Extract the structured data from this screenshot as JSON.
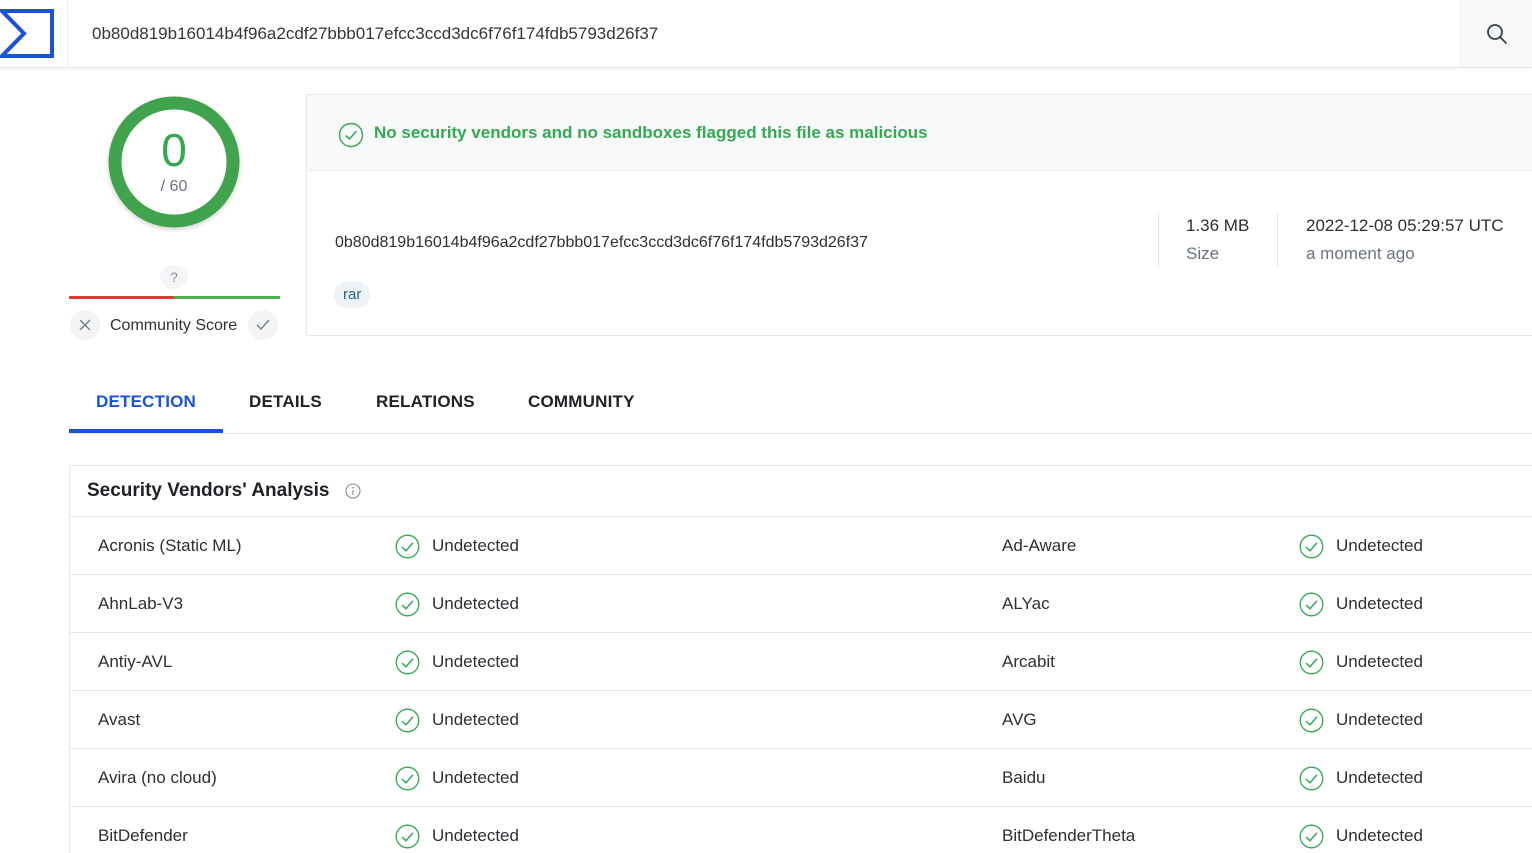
{
  "search": {
    "value": "0b80d819b16014b4f96a2cdf27bbb017efcc3ccd3dc6f76f174fdb5793d26f37",
    "icon": "search-icon"
  },
  "score": {
    "detections": "0",
    "total": "/ 60",
    "ring_color": "#34a853",
    "community_unknown": "?",
    "community_label": "Community Score"
  },
  "summary": {
    "status": "No security vendors and no sandboxes flagged this file as malicious",
    "hash": "0b80d819b16014b4f96a2cdf27bbb017efcc3ccd3dc6f76f174fdb5793d26f37",
    "tag": "rar",
    "size_value": "1.36 MB",
    "size_label": "Size",
    "date_value": "2022-12-08 05:29:57 UTC",
    "date_relative": "a moment ago"
  },
  "tabs": [
    {
      "label": "DETECTION",
      "active": true
    },
    {
      "label": "DETAILS",
      "active": false
    },
    {
      "label": "RELATIONS",
      "active": false
    },
    {
      "label": "COMMUNITY",
      "active": false
    }
  ],
  "analysis": {
    "title": "Security Vendors' Analysis",
    "rows": [
      {
        "left_vendor": "Acronis (Static ML)",
        "left_result": "Undetected",
        "right_vendor": "Ad-Aware",
        "right_result": "Undetected"
      },
      {
        "left_vendor": "AhnLab-V3",
        "left_result": "Undetected",
        "right_vendor": "ALYac",
        "right_result": "Undetected"
      },
      {
        "left_vendor": "Antiy-AVL",
        "left_result": "Undetected",
        "right_vendor": "Arcabit",
        "right_result": "Undetected"
      },
      {
        "left_vendor": "Avast",
        "left_result": "Undetected",
        "right_vendor": "AVG",
        "right_result": "Undetected"
      },
      {
        "left_vendor": "Avira (no cloud)",
        "left_result": "Undetected",
        "right_vendor": "Baidu",
        "right_result": "Undetected"
      },
      {
        "left_vendor": "BitDefender",
        "left_result": "Undetected",
        "right_vendor": "BitDefenderTheta",
        "right_result": "Undetected"
      }
    ]
  },
  "colors": {
    "accent": "#1a53d6",
    "clean": "#34a853",
    "malicious": "#e53935"
  }
}
